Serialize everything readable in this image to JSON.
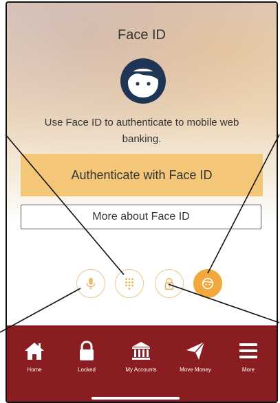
{
  "screen": {
    "title": "Face ID",
    "description": "Use Face ID to authenticate to mobile web banking.",
    "primary_button": "Authenticate with Face ID",
    "secondary_button": "More about Face ID"
  },
  "auth_methods": [
    {
      "icon": "microphone-icon",
      "active": false
    },
    {
      "icon": "keypad-icon",
      "active": false
    },
    {
      "icon": "lock-icon",
      "active": false
    },
    {
      "icon": "face-id-icon",
      "active": true
    }
  ],
  "nav": [
    {
      "label": "Home",
      "icon": "home-icon"
    },
    {
      "label": "Locked",
      "icon": "lock-icon"
    },
    {
      "label": "My Accounts",
      "icon": "bank-icon"
    },
    {
      "label": "Move Money",
      "icon": "send-icon"
    },
    {
      "label": "More",
      "icon": "menu-icon"
    }
  ],
  "colors": {
    "accent": "#f4c677",
    "active_method": "#f2a83c",
    "navbar": "#8a1d21",
    "face_icon": "#1f3556"
  }
}
